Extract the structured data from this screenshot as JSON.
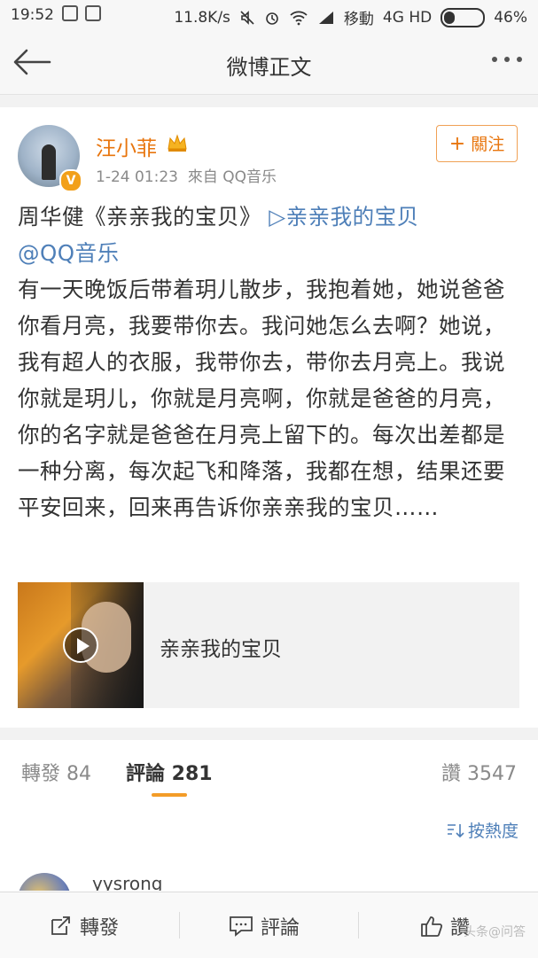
{
  "status_bar": {
    "time": "19:52",
    "speed": "11.8K/s",
    "carrier": "移動",
    "network": "4G HD",
    "battery": "46%"
  },
  "nav": {
    "title": "微博正文"
  },
  "post": {
    "author": "汪小菲",
    "timestamp": "1-24 01:23",
    "source": "來自 QQ音乐",
    "follow_label": "關注",
    "follow_plus": "+",
    "content_prefix": "周华健《亲亲我的宝贝》",
    "content_link": "▷亲亲我的宝贝",
    "content_mention": "@QQ音乐",
    "content_body": "有一天晚饭后带着玥儿散步，我抱着她，她说爸爸你看月亮，我要带你去。我问她怎么去啊？她说，我有超人的衣服，我带你去，带你去月亮上。我说你就是玥儿，你就是月亮啊，你就是爸爸的月亮，你的名字就是爸爸在月亮上留下的。每次出差都是一种分离，每次起飞和降落，我都在想，结果还要平安回来，回来再告诉你亲亲我的宝贝……",
    "media_title": "亲亲我的宝贝"
  },
  "tabs": {
    "repost": "轉發 84",
    "comment": "評論 281",
    "like": "讚 3547",
    "sort": "按熱度"
  },
  "comment_peek": {
    "user": "yysrong"
  },
  "bottom_bar": {
    "repost": "轉發",
    "comment": "評論",
    "like": "讚",
    "watermark": "头条@问答"
  }
}
